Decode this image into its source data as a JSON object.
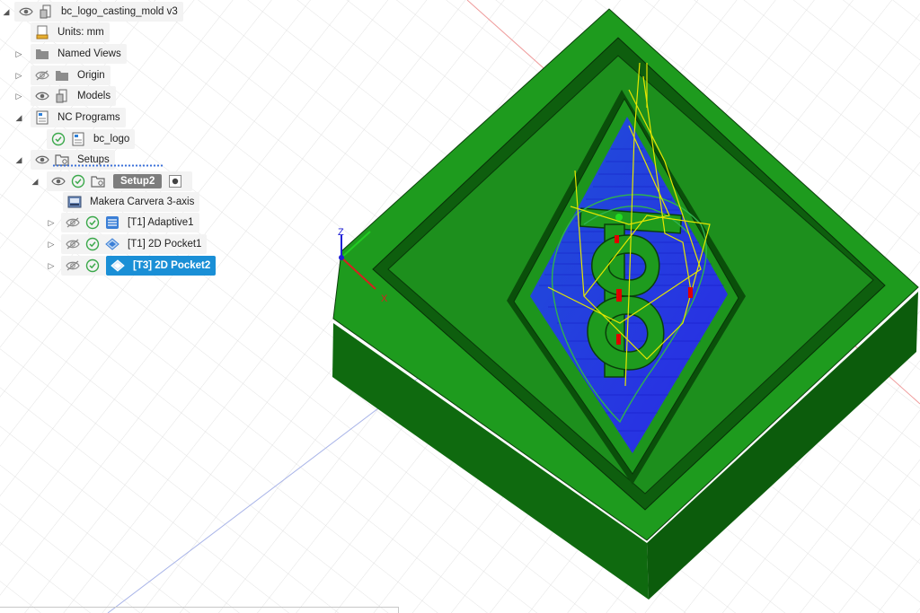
{
  "browser": {
    "root": {
      "label": "bc_logo_casting_mold v3"
    },
    "units": {
      "label": "Units: mm"
    },
    "named_views": {
      "label": "Named Views"
    },
    "origin": {
      "label": "Origin"
    },
    "models": {
      "label": "Models"
    },
    "nc_programs": {
      "label": "NC Programs"
    },
    "nc_program_item": {
      "label": "bc_logo"
    },
    "setups": {
      "label": "Setups"
    },
    "setup2": {
      "label": "Setup2"
    },
    "machine": {
      "label": "Makera Carvera 3-axis"
    },
    "ops": [
      {
        "label": "[T1] Adaptive1"
      },
      {
        "label": "[T1] 2D Pocket1"
      },
      {
        "label": "[T3] 2D Pocket2"
      }
    ]
  },
  "viewcube": {
    "z_label": "Z",
    "x_label": "X"
  },
  "colors": {
    "mold_green": "#1f9a1f",
    "mold_dark": "#0b560b",
    "toolpath_blue": "#1d1df0",
    "rapid_yellow": "#f2f200",
    "selection_blue": "#1a8fd6"
  }
}
